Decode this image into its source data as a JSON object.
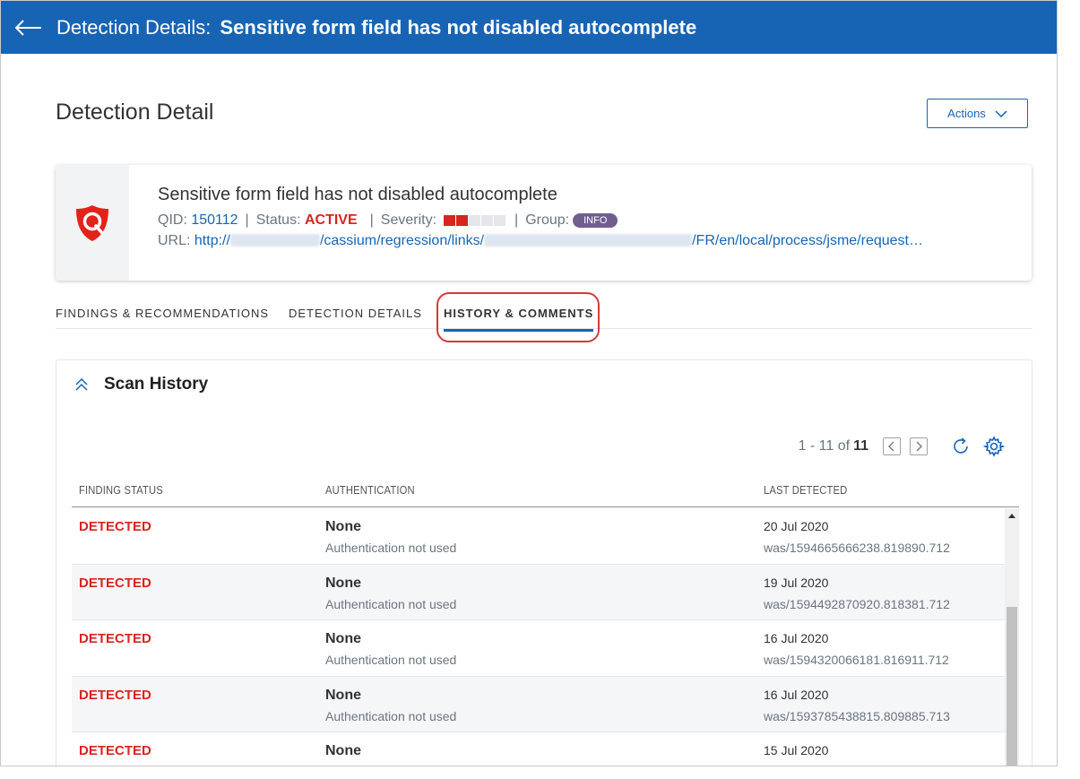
{
  "header": {
    "back_icon": "arrow-left-icon",
    "crumb": "Detection Details:",
    "title": "Sensitive form field has not disabled autocomplete",
    "bg_color": "#1764b5"
  },
  "page": {
    "title": "Detection Detail",
    "actions_label": "Actions"
  },
  "detection": {
    "name": "Sensitive form field has not disabled autocomplete",
    "qid_label": "QID:",
    "qid": "150112",
    "status_label": "Status:",
    "status": "ACTIVE",
    "severity_label": "Severity:",
    "severity_level": 2,
    "severity_max": 5,
    "group_label": "Group:",
    "group": "INFO",
    "url_label": "URL:",
    "url_part1": "http://",
    "url_part2": "/cassium/regression/links/",
    "url_part3": "/FR/en/local/process/jsme/request…",
    "logo_icon": "qualys-shield-logo"
  },
  "tabs": [
    {
      "label": "FINDINGS & RECOMMENDATIONS"
    },
    {
      "label": "DETECTION DETAILS"
    },
    {
      "label": "HISTORY & COMMENTS",
      "active": true
    }
  ],
  "scan_history": {
    "title": "Scan History",
    "pager_text": "1 - 11 of",
    "total": "11",
    "columns": [
      "FINDING STATUS",
      "AUTHENTICATION",
      "LAST DETECTED"
    ],
    "rows": [
      {
        "status": "DETECTED",
        "auth": "None",
        "auth_sub": "Authentication not used",
        "date": "20 Jul 2020",
        "scan": "was/1594665666238.819890.712"
      },
      {
        "status": "DETECTED",
        "auth": "None",
        "auth_sub": "Authentication not used",
        "date": "19 Jul 2020",
        "scan": "was/1594492870920.818381.712"
      },
      {
        "status": "DETECTED",
        "auth": "None",
        "auth_sub": "Authentication not used",
        "date": "16 Jul 2020",
        "scan": "was/1594320066181.816911.712"
      },
      {
        "status": "DETECTED",
        "auth": "None",
        "auth_sub": "Authentication not used",
        "date": "16 Jul 2020",
        "scan": "was/1593785438815.809885.713"
      },
      {
        "status": "DETECTED",
        "auth": "None",
        "auth_sub": "",
        "date": "15 Jul 2020",
        "scan": ""
      }
    ]
  },
  "colors": {
    "accent": "#1764b5",
    "status_red": "#d7261e",
    "badge_purple": "#6f5e8f",
    "highlight_red": "#d63a3a"
  }
}
